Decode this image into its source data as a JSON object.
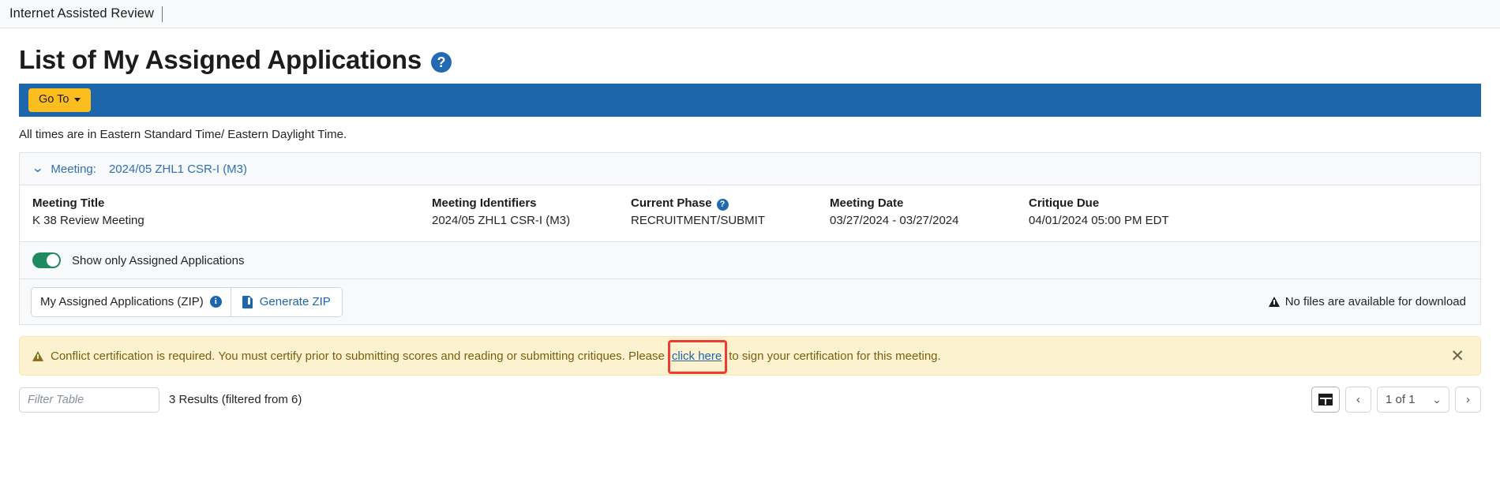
{
  "appbar": {
    "title": "Internet Assisted Review"
  },
  "page": {
    "title": "List of My Assigned Applications",
    "help_icon": "question-mark-circle-icon",
    "times_note": "All times are in Eastern Standard Time/ Eastern Daylight Time."
  },
  "action_bar": {
    "goto_label": "Go To"
  },
  "meeting_panel": {
    "header_label": "Meeting:",
    "header_value": "2024/05 ZHL1 CSR-I (M3)",
    "columns": [
      {
        "label": "Meeting Title",
        "value": "K 38 Review Meeting",
        "help": false
      },
      {
        "label": "Meeting Identifiers",
        "value": "2024/05 ZHL1 CSR-I (M3)",
        "help": false
      },
      {
        "label": "Current Phase",
        "value": "RECRUITMENT/SUBMIT",
        "help": true
      },
      {
        "label": "Meeting Date",
        "value": "03/27/2024 - 03/27/2024",
        "help": false
      },
      {
        "label": "Critique Due",
        "value": "04/01/2024 05:00 PM EDT",
        "help": false
      }
    ]
  },
  "toggle_strip": {
    "label": "Show only Assigned Applications",
    "state": "on"
  },
  "zip_strip": {
    "zip_label": "My Assigned Applications (ZIP)",
    "info_icon": "info-icon",
    "generate_label": "Generate ZIP",
    "no_files_text": "No files are available for download"
  },
  "alert": {
    "text_before": "Conflict certification is required. You must certify prior to submitting scores and reading or submitting critiques. Please",
    "link_text": "click here",
    "text_after": "to sign your certification for this meeting.",
    "close_icon": "close-icon",
    "warning_icon": "warning-triangle-icon",
    "highlight_color": "#ef3b36"
  },
  "bottom_bar": {
    "filter_placeholder": "Filter Table",
    "filter_value": "",
    "results_text": "3 Results (filtered from 6)",
    "grid_view_icon": "grid-view-icon",
    "prev_label": "‹",
    "page_label": "1 of 1",
    "next_label": "›"
  },
  "colors": {
    "accent_blue": "#1d66ab",
    "accent_yellow": "#fcbe1e",
    "link_blue": "#2f6fb2",
    "toggle_green": "#1f8a5f",
    "alert_bg": "#fdf2cf",
    "highlight_red": "#ef3b36"
  }
}
